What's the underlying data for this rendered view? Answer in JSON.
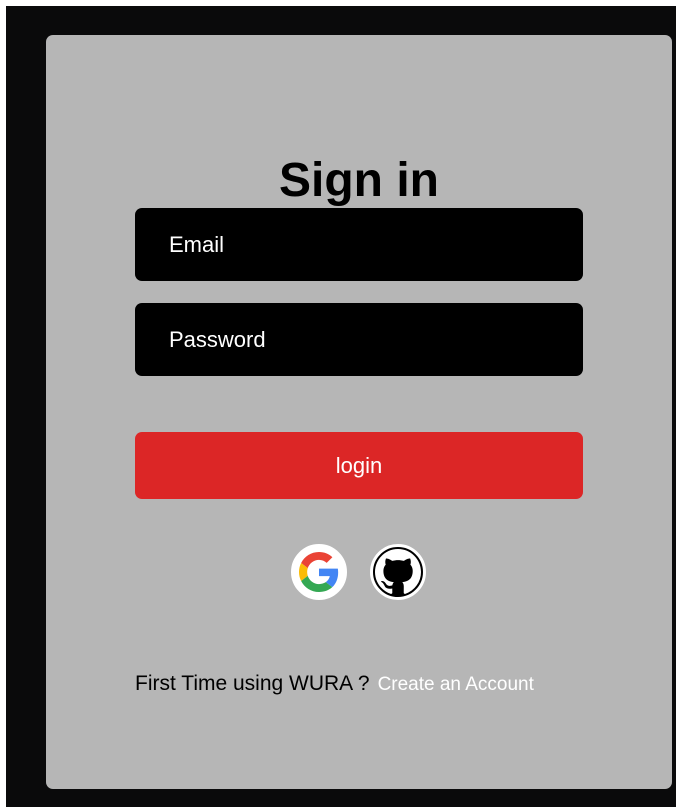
{
  "form": {
    "title": "Sign in",
    "email_placeholder": "Email",
    "password_placeholder": "Password",
    "login_label": "login"
  },
  "social": {
    "google_icon": "google-icon",
    "github_icon": "github-icon"
  },
  "footer": {
    "prompt_text": "First Time using WURA ?",
    "create_account_label": "Create an Account"
  },
  "colors": {
    "background": "#0a0a0b",
    "card": "#b6b6b6",
    "field": "#000000",
    "login_button": "#dc2626",
    "text_light": "#ffffff",
    "text_dark": "#000000"
  }
}
